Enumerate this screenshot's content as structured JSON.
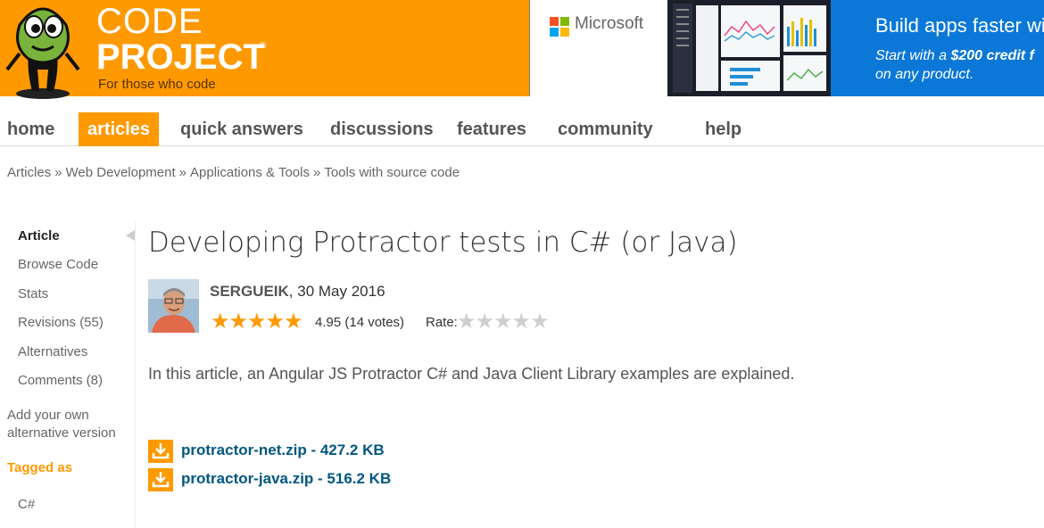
{
  "brand": {
    "line1": "CODE",
    "line2": "PROJECT",
    "registered": "®",
    "tagline": "For those who code"
  },
  "ad": {
    "sponsor": "Microsoft",
    "headline": "Build apps faster wit",
    "sub_prefix": "Start with a ",
    "sub_bold": "$200 credit f",
    "sub_line2": "on any product."
  },
  "nav": {
    "items": [
      {
        "label": "home"
      },
      {
        "label": "articles",
        "active": true
      },
      {
        "label": "quick answers"
      },
      {
        "label": "discussions"
      },
      {
        "label": "features"
      },
      {
        "label": "community"
      },
      {
        "label": "help"
      }
    ]
  },
  "breadcrumb": {
    "items": [
      "Articles",
      "Web Development",
      "Applications & Tools",
      "Tools with source code"
    ],
    "separator": "»"
  },
  "sidebar": {
    "items": [
      "Article",
      "Browse Code",
      "Stats",
      "Revisions (55)",
      "Alternatives",
      "Comments (8)"
    ],
    "alternative_line1": "Add your own",
    "alternative_line2": "alternative version",
    "tagged_label": "Tagged as",
    "tags": [
      "C#"
    ]
  },
  "article": {
    "title": "Developing Protractor tests in C# (or Java)",
    "author": "SERGUEIK",
    "date": ", 30 May 2016",
    "stars": "★★★★★",
    "rating_text": "4.95 (14 votes)",
    "rate_label": "Rate:",
    "rate_stars": "★★★★★",
    "summary": "In this article, an Angular JS Protractor C# and Java Client Library examples are explained.",
    "downloads": [
      {
        "label": "protractor-net.zip - 427.2 KB"
      },
      {
        "label": "protractor-java.zip - 516.2 KB"
      }
    ]
  },
  "colors": {
    "brand_orange": "#ff9900",
    "link_blue": "#005782",
    "ad_blue": "#0b78d7"
  }
}
